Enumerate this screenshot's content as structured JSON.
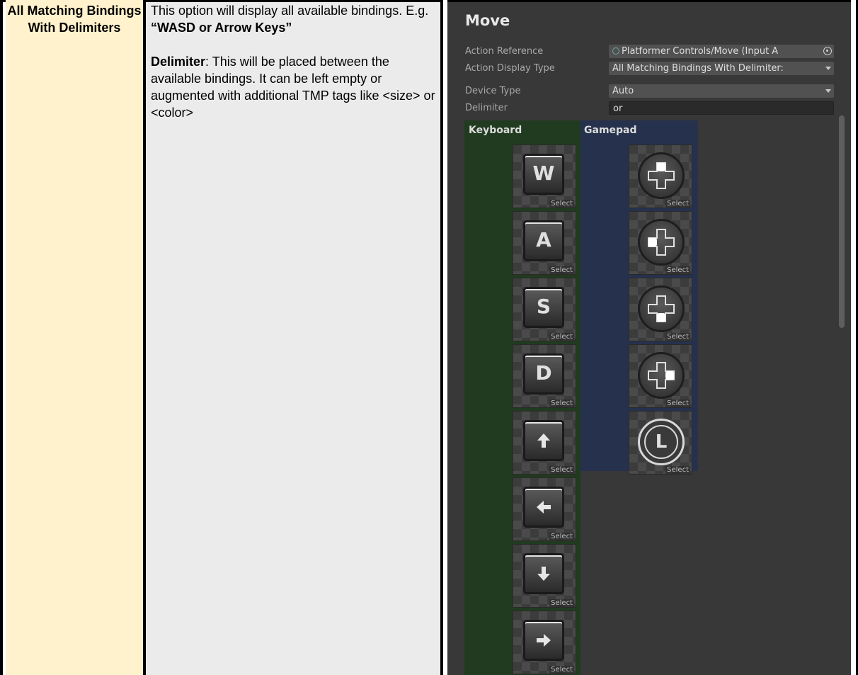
{
  "table": {
    "term": "All Matching Bindings With Delimiters",
    "description": {
      "line1_prefix": "This option will display all available bindings. E.g. ",
      "line1_example": "“WASD or Arrow Keys”",
      "delimiter_label": "Delimiter",
      "delimiter_text": ": This will be placed between the available bindings. It can be left empty or augmented with additional TMP tags like <size> or <color>"
    }
  },
  "inspector": {
    "title": "Move",
    "properties": [
      {
        "label": "Action Reference",
        "value": "Platformer Controls/Move (Input A",
        "icon": "input-action-icon",
        "suffix_icon": "target-picker-icon"
      },
      {
        "label": "Action Display Type",
        "value": "All Matching Bindings With Delimiter:",
        "dropdown": true
      },
      {
        "label": "Device Type",
        "value": "Auto",
        "dropdown": true
      },
      {
        "label": "Delimiter",
        "value": "or"
      }
    ],
    "keyboard": {
      "label": "Keyboard",
      "tiles": [
        {
          "glyph": "W",
          "kind": "letter",
          "select": "Select"
        },
        {
          "glyph": "A",
          "kind": "letter",
          "select": "Select"
        },
        {
          "glyph": "S",
          "kind": "letter",
          "select": "Select"
        },
        {
          "glyph": "D",
          "kind": "letter",
          "select": "Select"
        },
        {
          "glyph": "up-arrow-icon",
          "kind": "arrow",
          "select": "Select"
        },
        {
          "glyph": "left-arrow-icon",
          "kind": "arrow",
          "select": "Select"
        },
        {
          "glyph": "down-arrow-icon",
          "kind": "arrow",
          "select": "Select"
        },
        {
          "glyph": "right-arrow-icon",
          "kind": "arrow",
          "select": "Select"
        }
      ]
    },
    "gamepad": {
      "label": "Gamepad",
      "tiles": [
        {
          "glyph": "dpad-up-icon",
          "select": "Select"
        },
        {
          "glyph": "dpad-left-icon",
          "select": "Select"
        },
        {
          "glyph": "dpad-down-icon",
          "select": "Select"
        },
        {
          "glyph": "dpad-right-icon",
          "select": "Select"
        },
        {
          "glyph": "left-stick-icon",
          "label": "L",
          "select": "Select"
        }
      ]
    }
  }
}
